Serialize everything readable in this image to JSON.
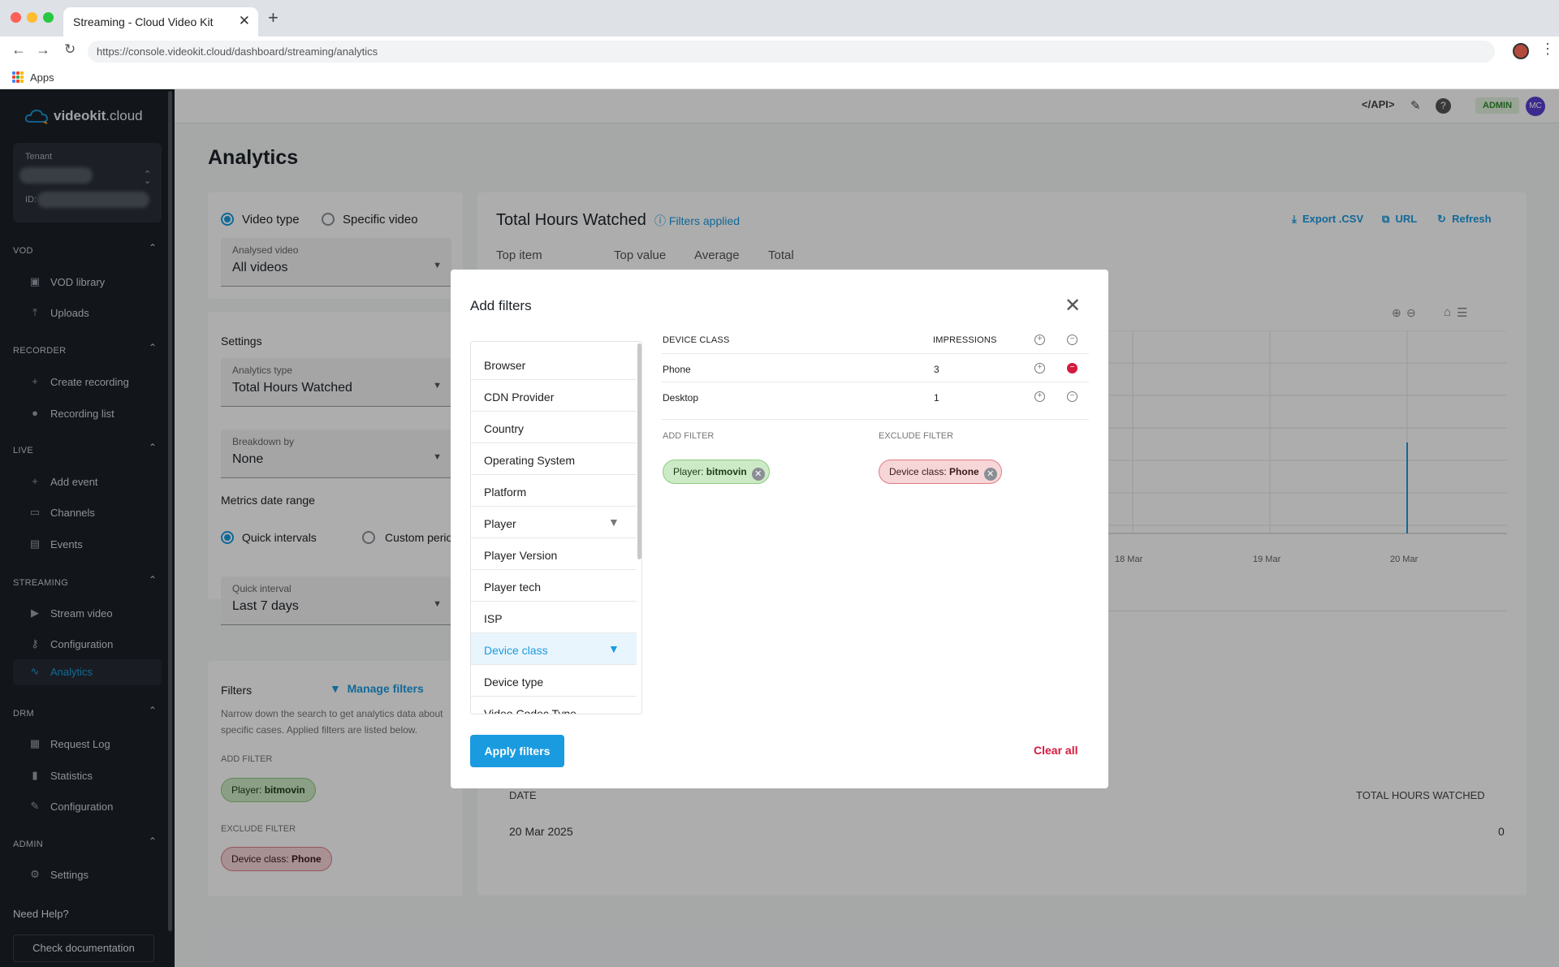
{
  "browser": {
    "tab_title": "Streaming - Cloud Video Kit",
    "url": "https://console.videokit.cloud/dashboard/streaming/analytics",
    "bookmarks_apps": "Apps"
  },
  "brand": {
    "logo_bold": "videokit",
    "logo_light": ".cloud"
  },
  "tenant": {
    "label": "Tenant",
    "id_label": "ID:"
  },
  "sidebar": {
    "sections": [
      {
        "title": "VOD",
        "items": [
          "VOD library",
          "Uploads"
        ]
      },
      {
        "title": "RECORDER",
        "items": [
          "Create recording",
          "Recording list"
        ]
      },
      {
        "title": "LIVE",
        "items": [
          "Add event",
          "Channels",
          "Events"
        ]
      },
      {
        "title": "STREAMING",
        "items": [
          "Stream video",
          "Configuration",
          "Analytics"
        ]
      },
      {
        "title": "DRM",
        "items": [
          "Request Log",
          "Statistics",
          "Configuration"
        ]
      },
      {
        "title": "ADMIN",
        "items": [
          "Settings"
        ]
      }
    ],
    "active_item": "Analytics",
    "need_help": "Need Help?",
    "check_docs": "Check documentation"
  },
  "topbar": {
    "api_label": "</API>",
    "admin_badge": "ADMIN",
    "user_initials": "MC"
  },
  "page": {
    "title": "Analytics"
  },
  "left_panel": {
    "radio_video_type": "Video type",
    "radio_specific_video": "Specific video",
    "analysed_video_label": "Analysed video",
    "analysed_video_value": "All videos",
    "settings_title": "Settings",
    "analytics_type_label": "Analytics type",
    "analytics_type_value": "Total Hours Watched",
    "breakdown_label": "Breakdown by",
    "breakdown_value": "None",
    "metrics_title": "Metrics date range",
    "radio_quick": "Quick intervals",
    "radio_custom": "Custom period",
    "quick_label": "Quick interval",
    "quick_value": "Last 7 days",
    "filters_title": "Filters",
    "manage_filters": "Manage filters",
    "filters_desc_1": "Narrow down the search to get analytics data about",
    "filters_desc_2": "specific cases. Applied filters are listed below.",
    "add_filter_label": "ADD FILTER",
    "exclude_filter_label": "EXCLUDE FILTER",
    "add_chip_key": "Player:",
    "add_chip_val": "bitmovin",
    "excl_chip_key": "Device class:",
    "excl_chip_val": "Phone"
  },
  "right_panel": {
    "title": "Total Hours Watched",
    "filters_applied": "Filters applied",
    "export_csv": "Export .CSV",
    "url_btn": "URL",
    "refresh": "Refresh",
    "stats_headers": [
      "Top item",
      "Top value",
      "Average",
      "Total"
    ],
    "x_ticks": [
      "18 Mar",
      "19 Mar",
      "20 Mar"
    ],
    "table_col_date": "DATE",
    "table_col_total": "TOTAL HOURS WATCHED",
    "table_row_date": "20 Mar 2025",
    "table_row_value": "0"
  },
  "modal": {
    "title": "Add filters",
    "categories": [
      "Browser",
      "CDN Provider",
      "Country",
      "Operating System",
      "Platform",
      "Player",
      "Player Version",
      "Player tech",
      "ISP",
      "Device class",
      "Device type",
      "Video Codec Type"
    ],
    "active_category": "Device class",
    "table_headers": {
      "name": "DEVICE CLASS",
      "impressions": "IMPRESSIONS"
    },
    "rows": [
      {
        "name": "Phone",
        "impressions": "3",
        "excluded": true
      },
      {
        "name": "Desktop",
        "impressions": "1",
        "excluded": false
      }
    ],
    "add_filter_label": "ADD FILTER",
    "exclude_filter_label": "EXCLUDE FILTER",
    "add_chip_key": "Player:",
    "add_chip_val": "bitmovin",
    "excl_chip_key": "Device class:",
    "excl_chip_val": "Phone",
    "apply_label": "Apply filters",
    "clear_label": "Clear all"
  },
  "colors": {
    "accent": "#1a9be0",
    "danger": "#d6193e",
    "sidebar_bg": "#1b2129",
    "include_chip_bg": "#cdeac6",
    "exclude_chip_bg": "#f7d6d8"
  }
}
